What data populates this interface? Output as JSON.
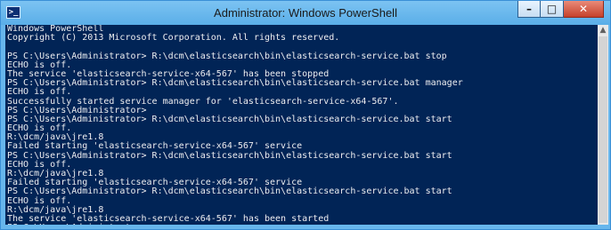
{
  "window": {
    "title": "Administrator: Windows PowerShell",
    "icon_glyph": ">_",
    "controls": {
      "minimize": "–",
      "maximize": "□",
      "close": "✕"
    }
  },
  "console": {
    "lines": [
      "Windows PowerShell",
      "Copyright (C) 2013 Microsoft Corporation. All rights reserved.",
      "",
      "PS C:\\Users\\Administrator> R:\\dcm\\elasticsearch\\bin\\elasticsearch-service.bat stop",
      "ECHO is off.",
      "The service 'elasticsearch-service-x64-567' has been stopped",
      "PS C:\\Users\\Administrator> R:\\dcm\\elasticsearch\\bin\\elasticsearch-service.bat manager",
      "ECHO is off.",
      "Successfully started service manager for 'elasticsearch-service-x64-567'.",
      "PS C:\\Users\\Administrator>",
      "PS C:\\Users\\Administrator> R:\\dcm\\elasticsearch\\bin\\elasticsearch-service.bat start",
      "ECHO is off.",
      "R:\\dcm/java\\jre1.8",
      "Failed starting 'elasticsearch-service-x64-567' service",
      "PS C:\\Users\\Administrator> R:\\dcm\\elasticsearch\\bin\\elasticsearch-service.bat start",
      "ECHO is off.",
      "R:\\dcm/java\\jre1.8",
      "Failed starting 'elasticsearch-service-x64-567' service",
      "PS C:\\Users\\Administrator> R:\\dcm\\elasticsearch\\bin\\elasticsearch-service.bat start",
      "ECHO is off.",
      "R:\\dcm/java\\jre1.8",
      "The service 'elasticsearch-service-x64-567' has been started"
    ],
    "prompt": "PS C:\\Users\\Administrator> "
  },
  "colors": {
    "console_bg": "#012456",
    "console_fg": "#eeedf0",
    "titlebar": "#67b6ec",
    "close_button": "#c7432d"
  },
  "icons": [
    "powershell-icon",
    "minimize-icon",
    "maximize-icon",
    "close-icon",
    "scroll-up-arrow-icon"
  ]
}
